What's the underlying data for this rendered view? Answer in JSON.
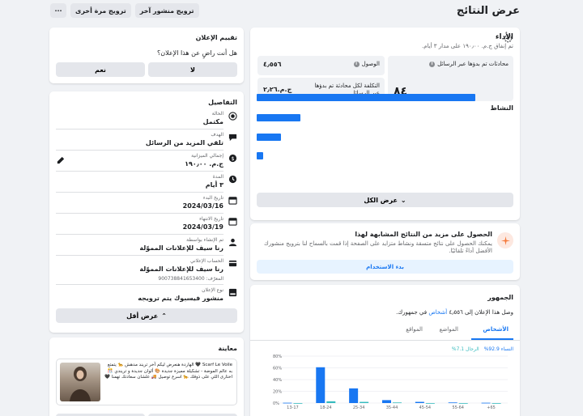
{
  "header": {
    "title": "عرض النتائج",
    "actions": [
      "ترويج منشور آخر",
      "ترويج مرة أخرى",
      "···"
    ]
  },
  "performance": {
    "title": "الأداء",
    "subtitle": "تم إنفاق ج.م.‏ ١٩٠٫٠٠ على مدار ٣ أيام.",
    "metrics": {
      "conversations_label": "محادثات تم بدؤها عبر الرسائل",
      "conversations_value": "٨٤",
      "reach_label": "الوصول",
      "reach_value": "٤٫٥٥٦",
      "cost_label": "التكلفة لكل محادثة تم بدؤها عبر الرسائل",
      "cost_value": "ج.م.‏٢٫٢٦"
    },
    "activity_label": "النشاط",
    "activity_bars": [
      1.0,
      0.2,
      0.11,
      0.03
    ],
    "see_all": "عرض الكل"
  },
  "recommendation": {
    "title": "الحصول على مزيد من النتائج المشابهة لهذا",
    "body": "يمكنك الحصول على نتائج متسقة ونشاط متزايد على الصفحة إذا قمت بالسماح لنا بترويج منشورك الأفضل أداءً تلقائيًا.",
    "button": "بدء الاستخدام"
  },
  "audience": {
    "title": "الجمهور",
    "description_prefix": "وصل هذا الإعلان إلى ٤٫٥٥٦ ",
    "description_link": "أشخاص",
    "description_suffix": " في جمهورك.",
    "tabs": [
      "الأشخاص",
      "المواضع",
      "المواقع"
    ],
    "legend_women": "النساء 92.9%",
    "legend_men": "الرجال 7.1%",
    "chart_data": {
      "type": "bar",
      "categories": [
        "13-17",
        "18-24",
        "25-34",
        "35-44",
        "45-54",
        "55-64",
        "65+"
      ],
      "series": [
        {
          "name": "النساء",
          "values": [
            0.5,
            61,
            25,
            5,
            2,
            1,
            0.5
          ]
        },
        {
          "name": "الرجال",
          "values": [
            0,
            3,
            2,
            1,
            0,
            0,
            0
          ]
        }
      ],
      "yticks": [
        "0%",
        "20%",
        "40%",
        "60%",
        "80%"
      ],
      "ylim": [
        0,
        80
      ]
    }
  },
  "rating": {
    "title": "تقييم الإعلان",
    "question": "هل أنت راضٍ عن هذا الإعلان؟",
    "no": "لا",
    "yes": "نعم"
  },
  "details": {
    "title": "التفاصيل",
    "rows": [
      {
        "label": "الحالة",
        "value": "مكتمل"
      },
      {
        "label": "الهدف",
        "value": "تلقي المزيد من الرسائل"
      },
      {
        "label": "إجمالي الميزانية",
        "value": "ج.م.‏ ١٩٠٫٠٠"
      },
      {
        "label": "المدة",
        "value": "٣ أيام"
      },
      {
        "label": "تاريخ البدء",
        "value": "2024/03/16"
      },
      {
        "label": "تاريخ الانتهاء",
        "value": "2024/03/19"
      },
      {
        "label": "تم الإنشاء بواسطة",
        "value": "رنا سيف للإعلانات المموّلة"
      },
      {
        "label": "الحساب الإعلاني",
        "value": "رنا سيف للإعلانات المموّلة",
        "extra": "المعرّف: 900738841653400"
      },
      {
        "label": "نوع الإعلان",
        "value": "منشور فيسبوك يتم ترويجه"
      }
    ],
    "see_less": "عرض أقل"
  },
  "preview": {
    "title": "معاينة",
    "text": "Scarf Le Voile 🖤 الهاردة هنعرض ليكم آخر تريند مدهش 🐆 يتمتع به عالم الموضة - تشكيلة مميزة جديدة 🎨 ألوان جديدة و تريندي 🎊 اختارى اللي على ذوقك 🐆 اسرع توصيل 🚚 علشان سعادتك تهمنا 🖤"
  },
  "colors": {
    "accent": "#1877f2",
    "teal": "#36bbbe"
  }
}
